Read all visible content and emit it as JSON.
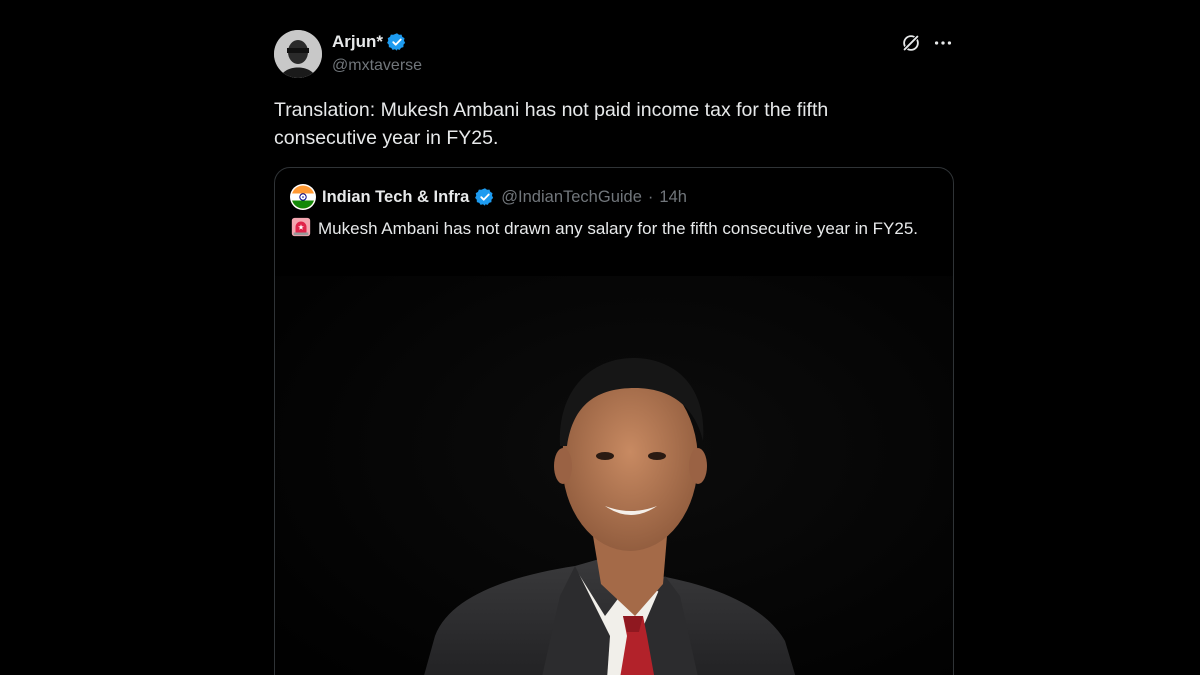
{
  "author": {
    "display_name": "Arjun*",
    "handle": "@mxtaverse"
  },
  "tweet": {
    "text": "Translation: Mukesh Ambani has not paid income tax for the fifth consecutive year in FY25."
  },
  "quoted_tweet": {
    "display_name": "Indian Tech & Infra",
    "handle": "@IndianTechGuide",
    "separator": "·",
    "time": "14h",
    "text": "Mukesh Ambani has not drawn any salary for the fifth consecutive year in FY25.",
    "emoji": "siren-icon",
    "media": "portrait-photo"
  },
  "icons": {
    "verified": "verified-badge-icon",
    "grok": "grok-icon",
    "more": "more-icon"
  },
  "colors": {
    "background": "#000000",
    "text_primary": "#e7e9ea",
    "text_secondary": "#71767b",
    "verified_blue": "#1d9bf0",
    "card_border": "#2f3336"
  }
}
